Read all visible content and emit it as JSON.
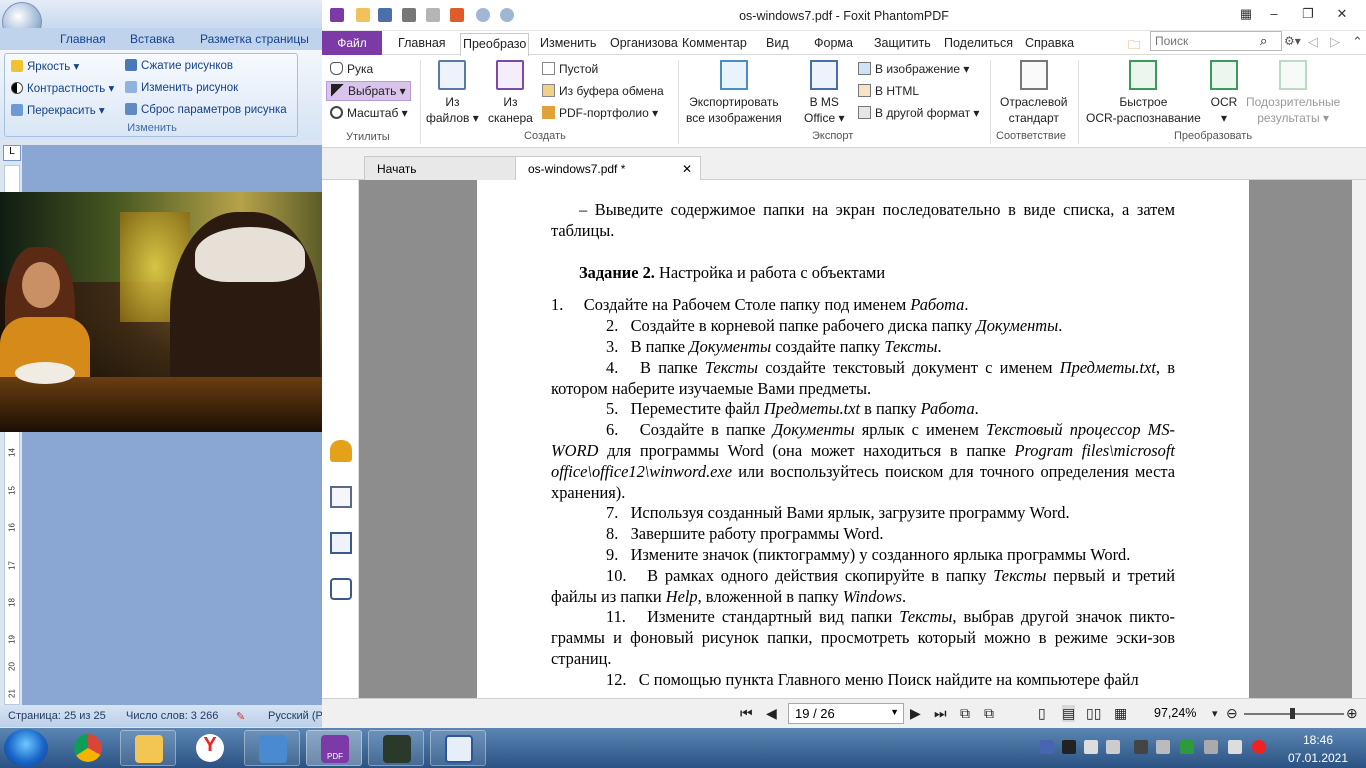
{
  "word": {
    "tabs": [
      "Главная",
      "Вставка",
      "Разметка страницы"
    ],
    "ribbon": {
      "brightness": "Яркость",
      "contrast": "Контрастность",
      "recolor": "Перекрасить",
      "compress": "Сжатие рисунков",
      "change": "Изменить рисунок",
      "reset": "Сброс параметров рисунка",
      "group_label": "Изменить"
    },
    "ruler_numbers": [
      "14",
      "15",
      "16",
      "17",
      "18",
      "19",
      "20",
      "21"
    ],
    "status": {
      "page": "Страница: 25 из 25",
      "words": "Число слов: 3 266",
      "lang": "Русский (Р"
    }
  },
  "foxit": {
    "title": "os-windows7.pdf - Foxit PhantomPDF",
    "tabs": {
      "file": "Файл",
      "home": "Главная",
      "convert": "Преобразо",
      "edit": "Изменить",
      "organize": "Организова",
      "comment": "Комментар",
      "view": "Вид",
      "form": "Форма",
      "protect": "Защитить",
      "share": "Поделиться",
      "help": "Справка"
    },
    "search_placeholder": "Поиск",
    "ribbon": {
      "hand": "Рука",
      "select": "Выбрать",
      "zoom": "Масштаб",
      "utilities_label": "Утилиты",
      "from_files": [
        "Из",
        "файлов"
      ],
      "from_scanner": [
        "Из",
        "сканера"
      ],
      "blank": "Пустой",
      "from_clipboard": "Из буфера обмена",
      "pdf_portfolio": "PDF-портфолио",
      "create_label": "Создать",
      "export_images": [
        "Экспортировать",
        "все изображения"
      ],
      "ms_office": [
        "В MS",
        "Office"
      ],
      "to_image": "В изображение",
      "to_html": "В HTML",
      "to_other": "В другой формат",
      "export_label": "Экспорт",
      "industry": [
        "Отраслевой",
        "стандарт"
      ],
      "compliance_label": "Соответствие",
      "quick_ocr": [
        "Быстрое",
        "OCR-распознавание"
      ],
      "ocr": "OCR",
      "suspect": [
        "Подозрительные",
        "результаты"
      ],
      "convert_label": "Преобразовать"
    },
    "doctabs": {
      "start": "Начать",
      "doc": "os-windows7.pdf *"
    },
    "page_box": "19 / 26",
    "zoom": "97,24%"
  },
  "document": {
    "line1": "–  Выведите содержимое папки на экран последовательно в виде списка, а затем таблицы.",
    "task_bold": "Задание 2.",
    "task_title": " Настройка и работа с объектами",
    "items": [
      {
        "n": "1.",
        "t": [
          "Создайте на Рабочем Столе папку под именем ",
          {
            "i": "Работа"
          },
          "."
        ]
      },
      {
        "n": "2.",
        "t": [
          "Создайте в корневой папке рабочего диска папку ",
          {
            "i": "Документы"
          },
          "."
        ]
      },
      {
        "n": "3.",
        "t": [
          "В папке ",
          {
            "i": "Документы"
          },
          " создайте папку ",
          {
            "i": "Тексты"
          },
          "."
        ]
      },
      {
        "n": "4.",
        "t": [
          "В папке ",
          {
            "i": "Тексты"
          },
          " создайте текстовый документ с именем ",
          {
            "i": "Предметы.txt"
          },
          ", в котором наберите изучаемые Вами предметы."
        ]
      },
      {
        "n": "5.",
        "t": [
          "Переместите файл ",
          {
            "i": "Предметы.txt"
          },
          " в папку ",
          {
            "i": "Работа"
          },
          "."
        ]
      },
      {
        "n": "6.",
        "t": [
          "Создайте в папке ",
          {
            "i": "Документы"
          },
          " ярлык с именем ",
          {
            "i": "Текстовый процессор MS-WORD"
          },
          " для программы Word (она может находиться в папке ",
          {
            "i": "Program files\\microsoft office\\office12\\winword.exe"
          },
          " или воспользуйтесь поиском для точного определения места хранения)."
        ]
      },
      {
        "n": "7.",
        "t": [
          "Используя созданный Вами ярлык, загрузите программу Word."
        ]
      },
      {
        "n": "8.",
        "t": [
          "Завершите работу программы Word."
        ]
      },
      {
        "n": "9.",
        "t": [
          "Измените значок (пиктограмму) у созданного ярлыка программы Word."
        ]
      },
      {
        "n": "10.",
        "t": [
          "В рамках одного действия скопируйте в папку ",
          {
            "i": "Тексты"
          },
          " первый и третий файлы из папки ",
          {
            "i": "Help"
          },
          ", вложенной в папку ",
          {
            "i": "Windows"
          },
          "."
        ]
      },
      {
        "n": "11.",
        "t": [
          "Измените стандартный вид папки ",
          {
            "i": "Тексты"
          },
          ", выбрав другой значок пикто-граммы и фоновый рисунок папки, просмотреть который можно в режиме эски-зов страниц."
        ]
      },
      {
        "n": "12.",
        "t": [
          "С помощью пункта Главного меню Поиск найдите на компьютере файл"
        ]
      }
    ]
  },
  "taskbar": {
    "time": "18:46",
    "date": "07.01.2021",
    "pdf_label": "PDF"
  }
}
